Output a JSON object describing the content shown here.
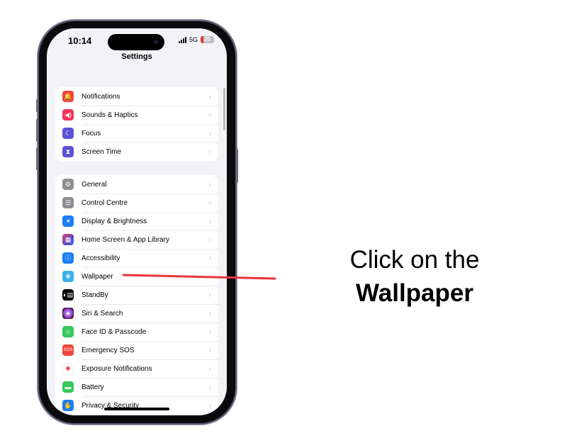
{
  "status_bar": {
    "time": "10:14",
    "network": "5G",
    "battery_level": "20",
    "battery_color": "#e53935"
  },
  "nav": {
    "title": "Settings"
  },
  "groups": [
    {
      "items": [
        {
          "label": "",
          "icon": "partial-green-icon",
          "color": "#34c759",
          "glyph": ""
        }
      ]
    },
    {
      "items": [
        {
          "label": "Notifications",
          "icon": "bell-icon",
          "color": "#f0453a",
          "glyph": "🔔"
        },
        {
          "label": "Sounds & Haptics",
          "icon": "speaker-icon",
          "color": "#f2335a",
          "glyph": "◀)"
        },
        {
          "label": "Focus",
          "icon": "moon-icon",
          "color": "#5b52d6",
          "glyph": "☾"
        },
        {
          "label": "Screen Time",
          "icon": "hourglass-icon",
          "color": "#5b52d6",
          "glyph": "⧗"
        }
      ]
    },
    {
      "items": [
        {
          "label": "General",
          "icon": "gear-icon",
          "color": "#8e8e93",
          "glyph": "⚙"
        },
        {
          "label": "Control Centre",
          "icon": "toggles-icon",
          "color": "#8e8e93",
          "glyph": "☰"
        },
        {
          "label": "Display & Brightness",
          "icon": "sun-icon",
          "color": "#1a7cf5",
          "glyph": "☀"
        },
        {
          "label": "Home Screen & App Library",
          "icon": "app-grid-icon",
          "color": "#6243c9",
          "glyph": "▦"
        },
        {
          "label": "Accessibility",
          "icon": "accessibility-icon",
          "color": "#1a7cf5",
          "glyph": "ⓘ"
        },
        {
          "label": "Wallpaper",
          "icon": "flower-icon",
          "color": "#3aaee8",
          "glyph": "❋"
        },
        {
          "label": "StandBy",
          "icon": "standby-icon",
          "color": "#000000",
          "glyph": "◐▤"
        },
        {
          "label": "Siri & Search",
          "icon": "siri-icon",
          "color": "#3a2350",
          "glyph": "●"
        },
        {
          "label": "Face ID & Passcode",
          "icon": "face-id-icon",
          "color": "#34c759",
          "glyph": "☺"
        },
        {
          "label": "Emergency SOS",
          "icon": "sos-icon",
          "color": "#f0453a",
          "glyph": "SOS"
        },
        {
          "label": "Exposure Notifications",
          "icon": "exposure-icon",
          "color": "#ffffff",
          "glyph": "✺"
        },
        {
          "label": "Battery",
          "icon": "battery-icon",
          "color": "#34c759",
          "glyph": "▬"
        },
        {
          "label": "Privacy & Security",
          "icon": "hand-icon",
          "color": "#1a7cf5",
          "glyph": "✋"
        }
      ]
    }
  ],
  "chevron": "›",
  "annotation": {
    "line1": "Click on the",
    "line2": "Wallpaper",
    "pointer_color": "#e8343c",
    "target": "Wallpaper"
  }
}
